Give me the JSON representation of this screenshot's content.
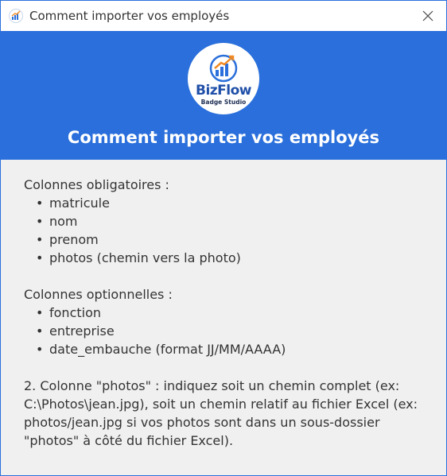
{
  "window": {
    "title": "Comment importer vos employés",
    "icons": {
      "app": "bizflow-logo-icon",
      "close": "close-icon"
    }
  },
  "header": {
    "logo_brand": "BizFlow",
    "logo_sub": "Badge Studio",
    "heading": "Comment importer vos employés",
    "colors": {
      "background": "#2a6fdb",
      "heading": "#ffffff"
    }
  },
  "content": {
    "required_title": "Colonnes obligatoires :",
    "required_items": [
      "matricule",
      "nom",
      "prenom",
      "photos  (chemin vers la photo)"
    ],
    "optional_title": "Colonnes optionnelles :",
    "optional_items": [
      "fonction",
      "entreprise",
      "date_embauche  (format JJ/MM/AAAA)"
    ],
    "note_lines": [
      "2. Colonne \"photos\" : indiquez soit un chemin complet (ex:",
      "C:\\Photos\\jean.jpg), soit un chemin relatif au fichier Excel (ex:",
      "photos/jean.jpg si vos photos sont dans un sous-dossier",
      "\"photos\" à côté du fichier Excel)."
    ]
  }
}
